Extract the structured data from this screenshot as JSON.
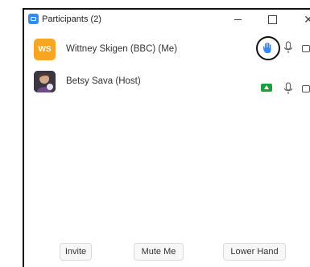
{
  "window": {
    "title": "Participants (2)"
  },
  "participants": [
    {
      "initials": "WS",
      "name": "Wittney Skigen (BBC) (Me)",
      "hand_raised": true,
      "avatar_color": "#F5A623"
    },
    {
      "name": "Betsy Sava (Host)",
      "video_on": true
    }
  ],
  "footer": {
    "invite_label": "Invite",
    "mute_label": "Mute Me",
    "lower_hand_label": "Lower Hand"
  },
  "colors": {
    "accent": "#2D8CFF",
    "video_green": "#1a9e40"
  }
}
